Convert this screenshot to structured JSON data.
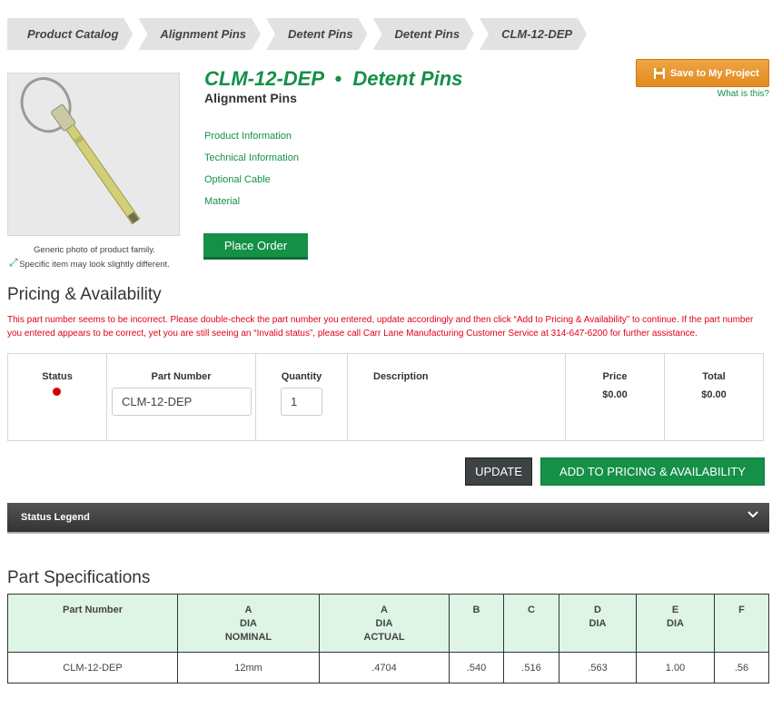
{
  "breadcrumb": [
    "Product Catalog",
    "Alignment Pins",
    "Detent Pins",
    "Detent Pins",
    "CLM-12-DEP"
  ],
  "product": {
    "title": "CLM-12-DEP  •  Detent Pins",
    "subtitle": "Alignment Pins",
    "image_note_1": "Generic photo of product family.",
    "image_note_2": "Specific item may look slightly different.",
    "links": [
      "Product Information",
      "Technical Information",
      "Optional Cable",
      "Material"
    ],
    "place_order": "Place Order",
    "save_project": "Save to My Project",
    "what_is_this": "What is this?"
  },
  "pricing": {
    "title": "Pricing & Availability",
    "error": "This part number seems to be incorrect. Please double-check the part number you entered, update accordingly and then click “Add to Pricing & Availability” to continue. If the part number you entered appears to be correct, yet you are still seeing an “Invalid status”, please call Carr Lane Manufacturing Customer Service at 314-647-6200 for further assistance.",
    "headers": {
      "status": "Status",
      "part_number": "Part Number",
      "quantity": "Quantity",
      "description": "Description",
      "price": "Price",
      "total": "Total"
    },
    "part_number_value": "CLM-12-DEP",
    "quantity_value": "1",
    "price_value": "$0.00",
    "total_value": "$0.00",
    "status_color": "#d40000"
  },
  "buttons": {
    "update": "UPDATE",
    "add": "ADD TO PRICING & AVAILABILITY"
  },
  "legend": {
    "label": "Status Legend"
  },
  "specs": {
    "title": "Part Specifications",
    "headers": [
      [
        "Part Number"
      ],
      [
        "A",
        "DIA",
        "NOMINAL"
      ],
      [
        "A",
        "DIA",
        "ACTUAL"
      ],
      [
        "B"
      ],
      [
        "C"
      ],
      [
        "D",
        "DIA"
      ],
      [
        "E",
        "DIA"
      ],
      [
        "F"
      ]
    ],
    "row": [
      "CLM-12-DEP",
      "12mm",
      ".4704",
      ".540",
      ".516",
      ".563",
      "1.00",
      ".56"
    ]
  },
  "colors": {
    "brand_green": "#149047",
    "header_bg": "#def5e6",
    "error": "#e0001a",
    "orange": "#e08a1e"
  }
}
